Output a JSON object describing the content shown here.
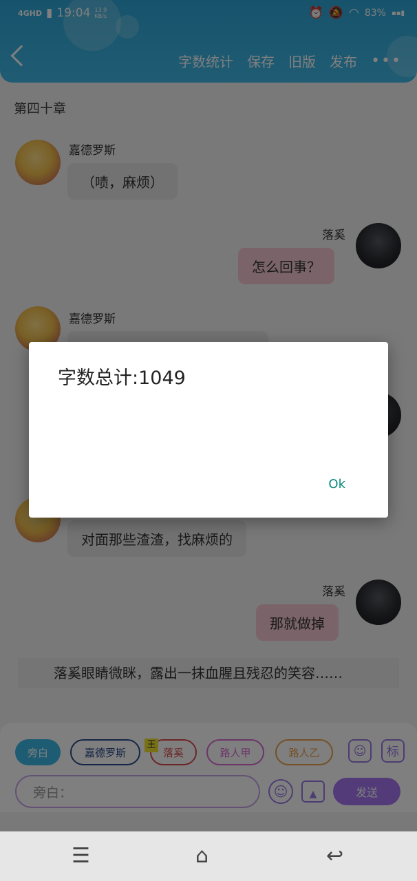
{
  "statusbar": {
    "network": "4GHD",
    "time": "19:04",
    "speed_value": "13.9",
    "speed_unit": "KB/s",
    "battery": "83%"
  },
  "toolbar": {
    "count_label": "字数统计",
    "save_label": "保存",
    "old_label": "旧版",
    "publish_label": "发布",
    "more_label": "•••"
  },
  "chapter_title": "第四十章",
  "messages": [
    {
      "speaker": "嘉德罗斯",
      "text": "（啧，麻烦）"
    },
    {
      "speaker": "落奚",
      "text": "怎么回事？"
    },
    {
      "speaker": "嘉德罗斯",
      "text": ""
    },
    {
      "speaker": "嘉德罗斯",
      "text": "对面那些渣渣，找麻烦的"
    },
    {
      "speaker": "落奚",
      "text": "那就做掉"
    }
  ],
  "narration": "落奚眼睛微眯，露出一抹血腥且残忍的笑容……",
  "composer": {
    "chips": [
      "旁白",
      "嘉德罗斯",
      "落奚",
      "路人甲",
      "路人乙"
    ],
    "main_badge": "王",
    "biao_label": "标",
    "input_placeholder": "旁白：",
    "send_label": "发送"
  },
  "dialog": {
    "message": "字数总计:1049",
    "ok_label": "Ok"
  },
  "colors": {
    "header": "#40b8e6",
    "accent_purple": "#a577f0",
    "ok_text": "#0a8a7c"
  }
}
